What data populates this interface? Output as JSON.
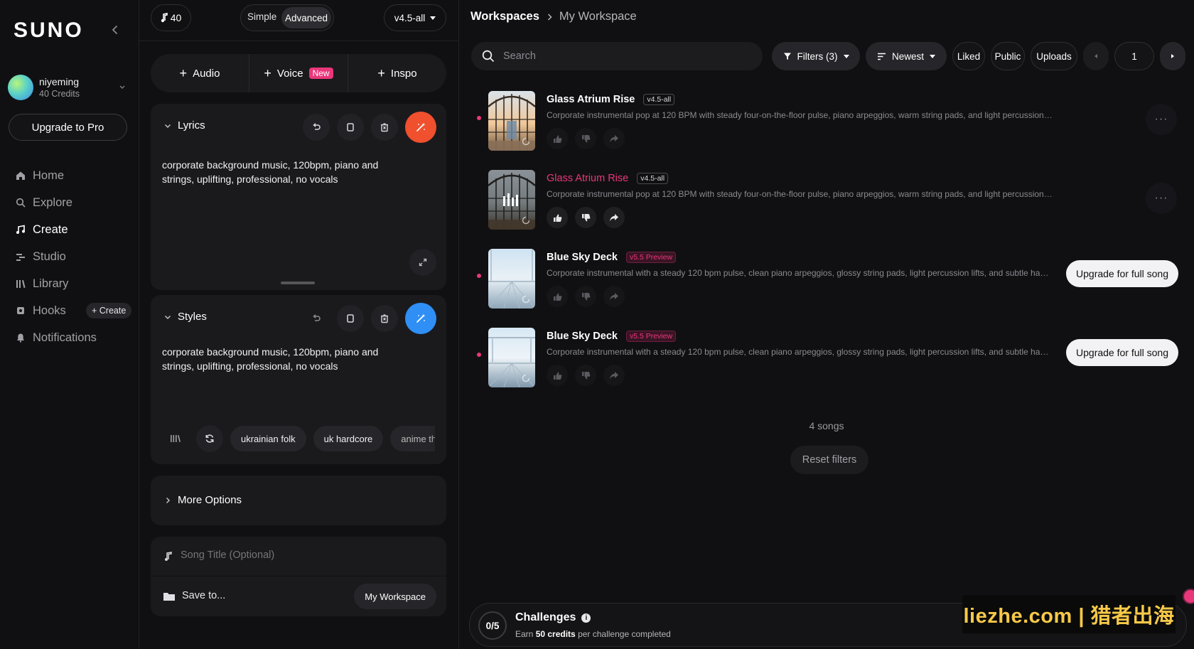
{
  "sidebar": {
    "logo": "SUNO",
    "user": {
      "name": "niyeming",
      "credits": "40 Credits"
    },
    "upgrade_label": "Upgrade to Pro",
    "nav": [
      {
        "label": "Home",
        "icon": "home-icon"
      },
      {
        "label": "Explore",
        "icon": "search-icon"
      },
      {
        "label": "Create",
        "icon": "create-icon",
        "active": true
      },
      {
        "label": "Studio",
        "icon": "studio-icon"
      },
      {
        "label": "Library",
        "icon": "library-icon"
      },
      {
        "label": "Hooks",
        "icon": "hooks-icon"
      },
      {
        "label": "Notifications",
        "icon": "bell-icon"
      }
    ],
    "hooks_create": "+ Create"
  },
  "create": {
    "credits": "40",
    "mode": {
      "simple": "Simple",
      "advanced": "Advanced",
      "selected": "Advanced"
    },
    "model": "v4.5-all",
    "add": {
      "audio": "Audio",
      "voice": "Voice",
      "voice_badge": "New",
      "inspo": "Inspo"
    },
    "lyrics": {
      "label": "Lyrics",
      "text": "corporate background music, 120bpm, piano and strings, uplifting, professional, no vocals"
    },
    "styles": {
      "label": "Styles",
      "text": "corporate background music, 120bpm, piano and strings, uplifting, professional, no vocals",
      "tags": [
        "ukrainian folk",
        "uk hardcore",
        "anime them"
      ]
    },
    "more_options": "More Options",
    "song_title_placeholder": "Song Title (Optional)",
    "save_to": "Save to...",
    "workspace": "My Workspace"
  },
  "workspace": {
    "breadcrumb": [
      "Workspaces",
      "My Workspace"
    ],
    "search_placeholder": "Search",
    "filters": "Filters (3)",
    "sort": "Newest",
    "liked": "Liked",
    "public": "Public",
    "uploads": "Uploads",
    "page": "1",
    "songs": [
      {
        "title": "Glass Atrium Rise",
        "version": "v4.5-all",
        "desc": "Corporate instrumental pop at 120 BPM with steady four-on-the-floor pulse, piano arpeggios, warm string pads, and light percussion accent...",
        "action": "more",
        "playing": false
      },
      {
        "title": "Glass Atrium Rise",
        "version": "v4.5-all",
        "desc": "Corporate instrumental pop at 120 BPM with steady four-on-the-floor pulse, piano arpeggios, warm string pads, and light percussion accent...",
        "action": "more",
        "playing": true
      },
      {
        "title": "Blue Sky Deck",
        "version": "v5.5 Preview",
        "desc": "Corporate instrumental with a steady 120 bpm pulse, clean piano arpeggios, glossy string pads, light percussion lifts, and subtle hand percu...",
        "action_label": "Upgrade for full song"
      },
      {
        "title": "Blue Sky Deck",
        "version": "v5.5 Preview",
        "desc": "Corporate instrumental with a steady 120 bpm pulse, clean piano arpeggios, glossy string pads, light percussion lifts, and subtle hand percu...",
        "action_label": "Upgrade for full song"
      }
    ],
    "count": "4 songs",
    "reset": "Reset filters",
    "challenges": {
      "progress": "0/5",
      "title": "Challenges",
      "sub_pre": "Earn ",
      "sub_bold": "50 credits",
      "sub_post": " per challenge completed"
    }
  },
  "watermark": "liezhe.com | 猎者出海",
  "colors": {
    "accent_pink": "#e9377b",
    "orange": "#f0502e",
    "blue": "#2f8ff5"
  }
}
